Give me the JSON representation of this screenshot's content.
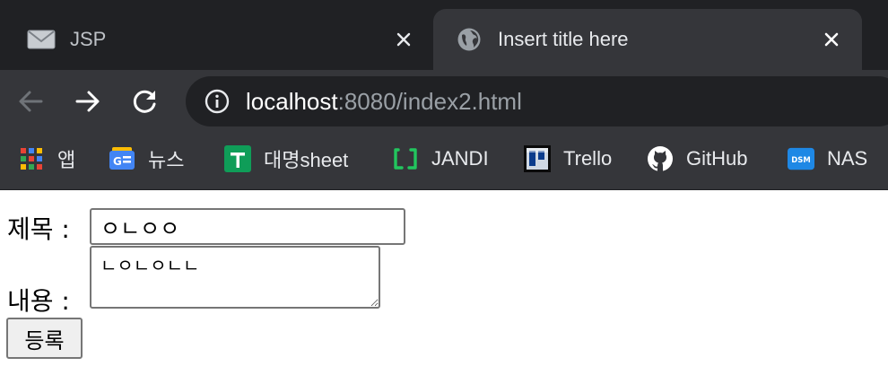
{
  "tabs": [
    {
      "title": "JSP",
      "icon": "mail-icon",
      "active": false
    },
    {
      "title": "Insert title here",
      "icon": "globe-icon",
      "active": true
    }
  ],
  "toolbar": {
    "back_icon": "back-arrow-icon",
    "forward_icon": "forward-arrow-icon",
    "reload_icon": "reload-icon",
    "url_host": "localhost",
    "url_rest": ":8080/index2.html",
    "info_icon": "info-icon"
  },
  "bookmarks": [
    {
      "label": "앱",
      "icon": "apps-grid-icon"
    },
    {
      "label": "뉴스",
      "icon": "google-news-icon"
    },
    {
      "label": "대명sheet",
      "icon": "sheets-icon"
    },
    {
      "label": "JANDI",
      "icon": "jandi-icon"
    },
    {
      "label": "Trello",
      "icon": "trello-icon"
    },
    {
      "label": "GitHub",
      "icon": "github-icon"
    },
    {
      "label": "NAS",
      "icon": "dsm-icon"
    }
  ],
  "bookmark_icon_text": {
    "dsm": "DSM"
  },
  "form": {
    "title_label": "제목 :",
    "title_value": "ㅇㄴㅇㅇ",
    "content_label": "내용 :",
    "content_value": "ㄴㅇㄴㅇㄴㄴ",
    "submit_label": "등록"
  },
  "colors": {
    "tabstrip": "#202124",
    "toolbar": "#35363a",
    "jandi": "#22c55e",
    "sheets": "#0f9d58",
    "dsm": "#1e88e5"
  }
}
